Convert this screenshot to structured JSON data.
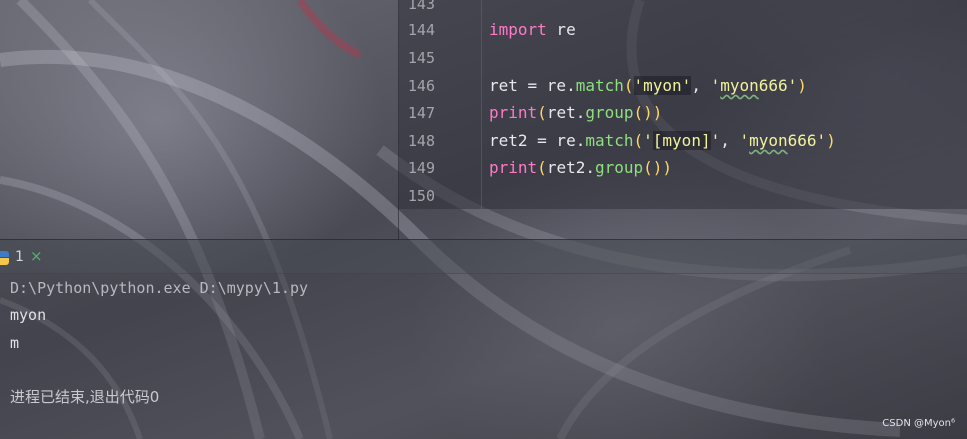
{
  "editor": {
    "lines": [
      {
        "num": "143"
      },
      {
        "num": "144"
      },
      {
        "num": "145"
      },
      {
        "num": "146"
      },
      {
        "num": "147"
      },
      {
        "num": "148"
      },
      {
        "num": "149"
      },
      {
        "num": "150"
      }
    ],
    "code": {
      "l144_kw": "import",
      "l144_rest": " re",
      "l146_a": "ret = re.",
      "l146_fn": "match",
      "l146_p1": "(",
      "l146_s1": "'myon'",
      "l146_comma": ", ",
      "l146_s2a": "'",
      "l146_s2b": "myon",
      "l146_s2c": "666'",
      "l146_p2": ")",
      "l147_kw": "print",
      "l147_p1": "(",
      "l147_a": "ret.",
      "l147_fn": "group",
      "l147_p2": "())",
      "l148_a": "ret2 = re.",
      "l148_fn": "match",
      "l148_p1": "(",
      "l148_s1a": "'",
      "l148_s1b": "[myon]",
      "l148_s1c": "'",
      "l148_comma": ", ",
      "l148_s2a": "'",
      "l148_s2b": "myon",
      "l148_s2c": "666'",
      "l148_p2": ")",
      "l149_kw": "print",
      "l149_p1": "(",
      "l149_a": "ret2.",
      "l149_fn": "group",
      "l149_p2": "())"
    }
  },
  "run_tab": {
    "number": "1",
    "close_glyph": "×",
    "icon": "python-icon"
  },
  "console": {
    "command": "D:\\Python\\python.exe D:\\mypy\\1.py",
    "output_1": "myon",
    "output_2": "m",
    "exit_message": "进程已结束,退出代码0"
  },
  "watermark": "CSDN @Myon⁶",
  "colors": {
    "keyword": "#ff79c6",
    "function": "#8ee07e",
    "string": "#f1f29b",
    "paren": "#ffd866",
    "run_close": "#58b26a"
  }
}
